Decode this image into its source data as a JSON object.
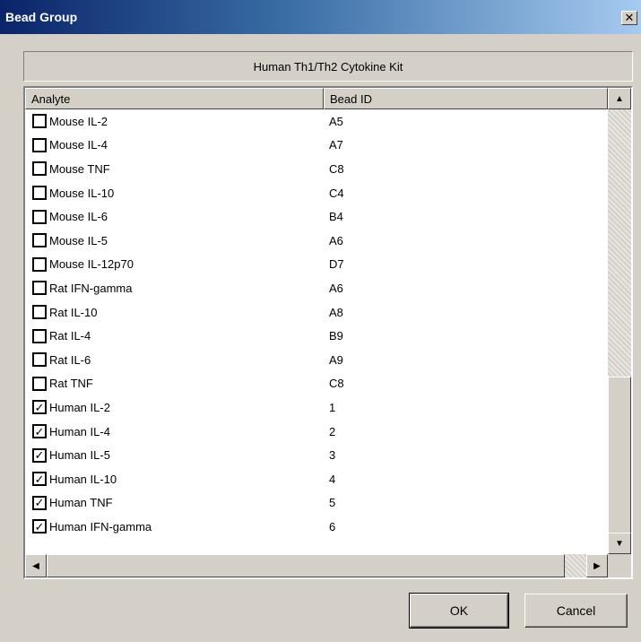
{
  "window": {
    "title": "Bead Group",
    "close_glyph": "✕"
  },
  "kit_label": "Human Th1/Th2 Cytokine Kit",
  "list": {
    "columns": [
      "Analyte",
      "Bead ID"
    ],
    "rows": [
      {
        "analyte": "Mouse IL-2",
        "bead_id": "A5",
        "checked": false
      },
      {
        "analyte": "Mouse IL-4",
        "bead_id": "A7",
        "checked": false
      },
      {
        "analyte": "Mouse TNF",
        "bead_id": "C8",
        "checked": false
      },
      {
        "analyte": "Mouse IL-10",
        "bead_id": "C4",
        "checked": false
      },
      {
        "analyte": "Mouse IL-6",
        "bead_id": "B4",
        "checked": false
      },
      {
        "analyte": "Mouse IL-5",
        "bead_id": "A6",
        "checked": false
      },
      {
        "analyte": "Mouse IL-12p70",
        "bead_id": "D7",
        "checked": false
      },
      {
        "analyte": "Rat IFN-gamma",
        "bead_id": "A6",
        "checked": false
      },
      {
        "analyte": "Rat IL-10",
        "bead_id": "A8",
        "checked": false
      },
      {
        "analyte": "Rat IL-4",
        "bead_id": "B9",
        "checked": false
      },
      {
        "analyte": "Rat IL-6",
        "bead_id": "A9",
        "checked": false
      },
      {
        "analyte": "Rat TNF",
        "bead_id": "C8",
        "checked": false
      },
      {
        "analyte": "Human IL-2",
        "bead_id": "1",
        "checked": true
      },
      {
        "analyte": "Human IL-4",
        "bead_id": "2",
        "checked": true
      },
      {
        "analyte": "Human IL-5",
        "bead_id": "3",
        "checked": true
      },
      {
        "analyte": "Human IL-10",
        "bead_id": "4",
        "checked": true
      },
      {
        "analyte": "Human TNF",
        "bead_id": "5",
        "checked": true
      },
      {
        "analyte": "Human IFN-gamma",
        "bead_id": "6",
        "checked": true
      }
    ]
  },
  "scroll": {
    "up_glyph": "▲",
    "down_glyph": "▼",
    "left_glyph": "◀",
    "right_glyph": "▶"
  },
  "buttons": {
    "ok": "OK",
    "cancel": "Cancel"
  },
  "colors": {
    "dialog_bg": "#d4d0c8",
    "titlebar_start": "#0a246a",
    "titlebar_end": "#a6caf0"
  }
}
